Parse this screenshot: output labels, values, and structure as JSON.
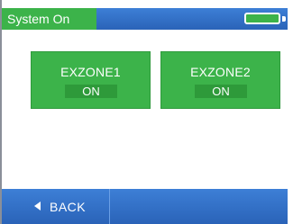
{
  "header": {
    "title": "System On",
    "battery_icon": "battery-full-icon"
  },
  "zones": [
    {
      "name": "EXZONE1",
      "state": "ON"
    },
    {
      "name": "EXZONE2",
      "state": "ON"
    }
  ],
  "footer": {
    "back_label": "BACK",
    "back_icon": "back-arrow-icon"
  },
  "colors": {
    "accent_green": "#3cb34a",
    "bar_blue": "#2a63b8"
  }
}
